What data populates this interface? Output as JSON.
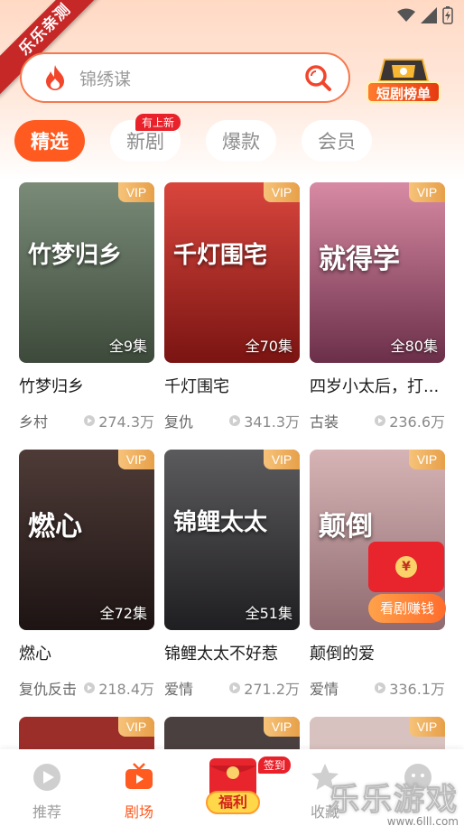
{
  "corner_ribbon": "乐乐亲测",
  "search": {
    "placeholder": "锦绣谋"
  },
  "rank": {
    "label": "短剧榜单"
  },
  "tabs": [
    {
      "label": "精选",
      "active": true
    },
    {
      "label": "新剧",
      "badge": "有上新"
    },
    {
      "label": "爆款"
    },
    {
      "label": "会员"
    }
  ],
  "vip_label": "VIP",
  "dramas": [
    {
      "title": "竹梦归乡",
      "episodes": "全9集",
      "tag": "乡村",
      "views": "274.3万",
      "poster_text": "竹梦归乡",
      "color_top": "#7a8b78",
      "color_bottom": "#3d4a3b"
    },
    {
      "title": "千灯围宅",
      "episodes": "全70集",
      "tag": "复仇",
      "views": "341.3万",
      "poster_text": "千灯围宅",
      "color_top": "#d9463d",
      "color_bottom": "#7a1412"
    },
    {
      "title": "四岁小太后，打...",
      "episodes": "全80集",
      "tag": "古装",
      "views": "236.6万",
      "poster_text": "就得学",
      "color_top": "#d88aa3",
      "color_bottom": "#6b2f49"
    },
    {
      "title": "燃心",
      "episodes": "全72集",
      "tag": "复仇反击",
      "views": "218.4万",
      "poster_text": "燃心",
      "color_top": "#4e3b37",
      "color_bottom": "#1d1413"
    },
    {
      "title": "锦鲤太太不好惹",
      "episodes": "全51集",
      "tag": "爱情",
      "views": "271.2万",
      "poster_text": "锦鲤太太",
      "color_top": "#5b5a5c",
      "color_bottom": "#1f1e21"
    },
    {
      "title": "颠倒的爱",
      "episodes": "",
      "tag": "爱情",
      "views": "336.1万",
      "poster_text": "颠倒",
      "color_top": "#d6b4b5",
      "color_bottom": "#8f6a70"
    }
  ],
  "third_row_colors": [
    "#9c2e2a",
    "#4a4040",
    "#d8c2bf"
  ],
  "redpacket": {
    "coin": "¥",
    "label": "看剧赚钱"
  },
  "bottom_nav": [
    {
      "label": "推荐",
      "active": false
    },
    {
      "label": "剧场",
      "active": true
    },
    {
      "label": "福利",
      "badge": "签到"
    },
    {
      "label": "收藏",
      "active": false
    }
  ],
  "watermark": {
    "big": "乐乐游戏",
    "small": "www.6lll.com"
  },
  "colors": {
    "accent": "#ff5a1f",
    "badge_red": "#e8212a"
  }
}
